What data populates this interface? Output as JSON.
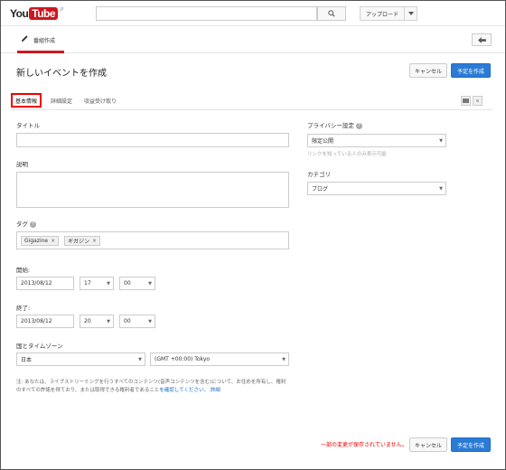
{
  "header": {
    "logo_you": "You",
    "logo_tube": "Tube",
    "logo_region": "JP",
    "upload_label": "アップロード"
  },
  "subnav": {
    "tab_label": "番組作成"
  },
  "page": {
    "title": "新しいイベントを作成",
    "cancel_label": "キャンセル",
    "create_label": "予定を作成"
  },
  "tabs": {
    "basic": "基本情報",
    "advanced": "詳細設定",
    "monetization": "収益受け取り"
  },
  "form": {
    "title_label": "タイトル",
    "title_value": "",
    "description_label": "説明",
    "description_value": "",
    "tags_label": "タグ",
    "tags": [
      "Gigazine",
      "ギガジン"
    ],
    "start_label": "開始:",
    "start_date": "2013/08/12",
    "start_hour": "17",
    "start_minute": "00",
    "end_label": "終了:",
    "end_date": "2013/08/12",
    "end_hour": "20",
    "end_minute": "00",
    "tz_label": "国とタイムゾーン",
    "country": "日本",
    "timezone": "(GMT +00:00) Tokyo"
  },
  "privacy": {
    "label": "プライバシー設定",
    "value": "限定公開",
    "hint": "リンクを知っている人のみ表示可能"
  },
  "category": {
    "label": "カテゴリ",
    "value": "ブログ"
  },
  "note": {
    "text": "注: あなたは、ライブストリーミングを行うすべてのコンテンツ(音声コンテンツを含む)について、お住めを所有し、権利のすべての許諾を得ており、または取得できる権利者であること",
    "link_text": "を確認してください。",
    "link2_text": "詳細"
  },
  "footer": {
    "unsaved_text": "一部の変更が保存されていません。",
    "cancel_label": "キャンセル",
    "create_label": "予定を作成"
  }
}
